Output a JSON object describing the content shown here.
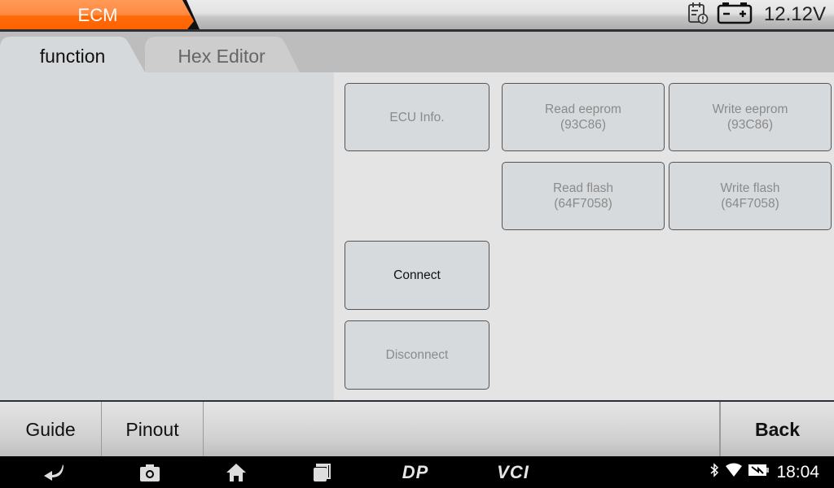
{
  "header": {
    "title": "ECM",
    "voltage": "12.12V",
    "icons": [
      "calendar-alert-icon",
      "battery-voltage-icon"
    ],
    "accent_color": "#ff6a10"
  },
  "tabs": [
    {
      "label": "function",
      "active": true
    },
    {
      "label": "Hex Editor",
      "active": false
    }
  ],
  "functions": {
    "ecu_info": "ECU Info.",
    "read_eeprom": [
      "Read eeprom",
      "(93C86)"
    ],
    "write_eeprom": [
      "Write eeprom",
      "(93C86)"
    ],
    "read_flash": [
      "Read flash",
      "(64F7058)"
    ],
    "write_flash": [
      "Write flash",
      "(64F7058)"
    ],
    "connect": "Connect",
    "disconnect": "Disconnect"
  },
  "bottom_bar": {
    "guide": "Guide",
    "pinout": "Pinout",
    "back": "Back"
  },
  "nav_bar": {
    "icons": [
      "back-icon",
      "camera-icon",
      "home-icon",
      "recents-icon",
      "dp-icon",
      "vci-icon"
    ],
    "dp_label": "DP",
    "vci_label": "VCI",
    "status_icons": [
      "bluetooth-icon",
      "wifi-icon",
      "battery-charging-icon"
    ],
    "time": "18:04"
  }
}
